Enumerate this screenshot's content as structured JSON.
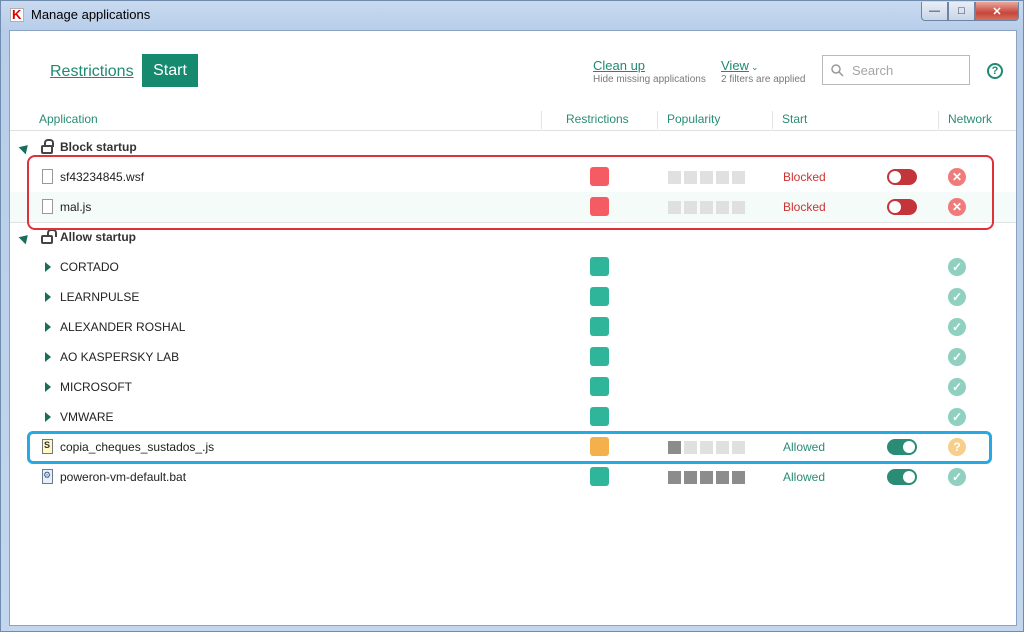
{
  "window": {
    "title": "Manage applications",
    "btn_min": "—",
    "btn_max": "□",
    "btn_close": "✕"
  },
  "toolbar": {
    "restrictions_tab": "Restrictions",
    "start_tab": "Start",
    "cleanup_link": "Clean up",
    "cleanup_hint": "Hide missing applications",
    "view_link": "View",
    "view_hint": "2 filters are applied",
    "search_placeholder": "Search",
    "help": "?"
  },
  "columns": {
    "application": "Application",
    "restrictions": "Restrictions",
    "popularity": "Popularity",
    "start": "Start",
    "network": "Network"
  },
  "groups": {
    "block": {
      "label": "Block startup"
    },
    "allow": {
      "label": "Allow startup"
    }
  },
  "rows": [
    {
      "name": "sf43234845.wsf",
      "restriction_color": "#f45b63",
      "popularity": 0,
      "start": "Blocked",
      "network": "blocked"
    },
    {
      "name": "mal.js",
      "restriction_color": "#f45b63",
      "popularity": 0,
      "start": "Blocked",
      "network": "blocked"
    },
    {
      "name": "CORTADO",
      "restriction_color": "#2fb59a",
      "network": "allowed"
    },
    {
      "name": "LEARNPULSE",
      "restriction_color": "#2fb59a",
      "network": "allowed"
    },
    {
      "name": "ALEXANDER ROSHAL",
      "restriction_color": "#2fb59a",
      "network": "allowed"
    },
    {
      "name": "AO KASPERSKY LAB",
      "restriction_color": "#2fb59a",
      "network": "allowed"
    },
    {
      "name": "MICROSOFT",
      "restriction_color": "#2fb59a",
      "network": "allowed"
    },
    {
      "name": "VMWARE",
      "restriction_color": "#2fb59a",
      "network": "allowed"
    },
    {
      "name": "copia_cheques_sustados_.js",
      "restriction_color": "#f4b04a",
      "popularity": 1,
      "start": "Allowed",
      "network": "unknown"
    },
    {
      "name": "poweron-vm-default.bat",
      "restriction_color": "#2fb59a",
      "popularity": 5,
      "start": "Allowed",
      "network": "allowed"
    }
  ],
  "icons": {
    "network_blocked": "✕",
    "network_allowed": "✓",
    "network_unknown": "?"
  }
}
